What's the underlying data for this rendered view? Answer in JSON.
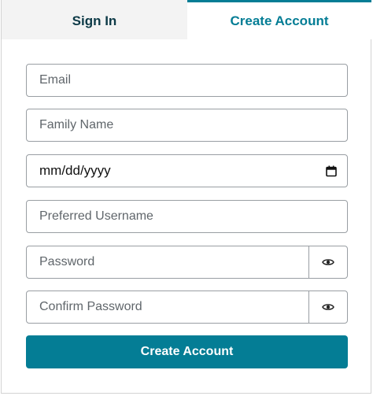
{
  "tabs": {
    "sign_in": "Sign In",
    "create_account": "Create Account",
    "active": "create_account"
  },
  "form": {
    "email_placeholder": "Email",
    "family_name_placeholder": "Family Name",
    "date_placeholder": "mm/dd/yyyy",
    "preferred_username_placeholder": "Preferred Username",
    "password_placeholder": "Password",
    "confirm_password_placeholder": "Confirm Password",
    "submit_label": "Create Account"
  },
  "colors": {
    "accent": "#047d95",
    "tab_inactive_bg": "#f3f3f3",
    "tab_inactive_text": "#0d3a47",
    "field_border": "#999ea3"
  },
  "icons": {
    "date": "calendar-icon",
    "password_toggle": "eye-icon"
  }
}
